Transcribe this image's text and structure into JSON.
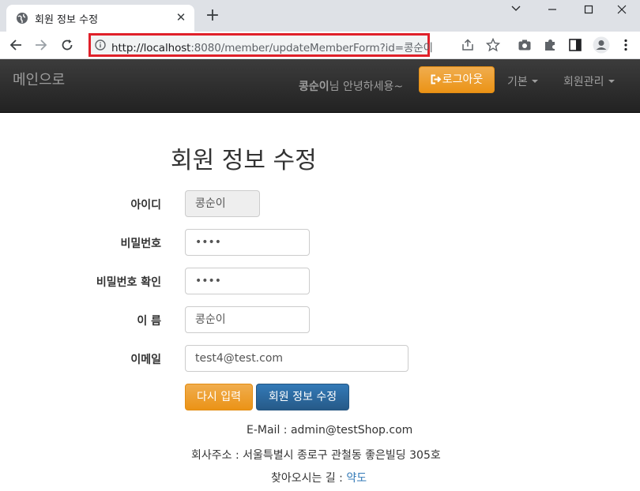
{
  "browser": {
    "tab_title": "회원 정보 수정",
    "url_host": "http://localhost",
    "url_rest": ":8080/member/updateMemberForm?id=콩순이"
  },
  "navbar": {
    "brand": "메인으로",
    "user_name": "콩순이",
    "greeting_suffix": "님 안녕하세용~",
    "logout_label": "로그아웃",
    "menu_basic": "기본",
    "menu_members": "회원관리"
  },
  "form": {
    "title": "회원 정보 수정",
    "id_label": "아이디",
    "id_value": "콩순이",
    "password_label": "비밀번호",
    "password_value": "••••",
    "password_confirm_label": "비밀번호 확인",
    "password_confirm_value": "••••",
    "name_label": "이 름",
    "name_value": "콩순이",
    "email_label": "이메일",
    "email_value": "test4@test.com",
    "reset_button": "다시 입력",
    "submit_button": "회원 정보 수정"
  },
  "footer": {
    "email": "E-Mail : admin@testShop.com",
    "address": "회사주소 : 서울특별시 종로구 관철동 좋은빌딩 305호",
    "directions_prefix": "찾아오시는 길 : ",
    "directions_link": "약도"
  },
  "colors": {
    "orange": "#f0ad4e",
    "blue": "#337ab7",
    "url_highlight": "#e0202a"
  }
}
